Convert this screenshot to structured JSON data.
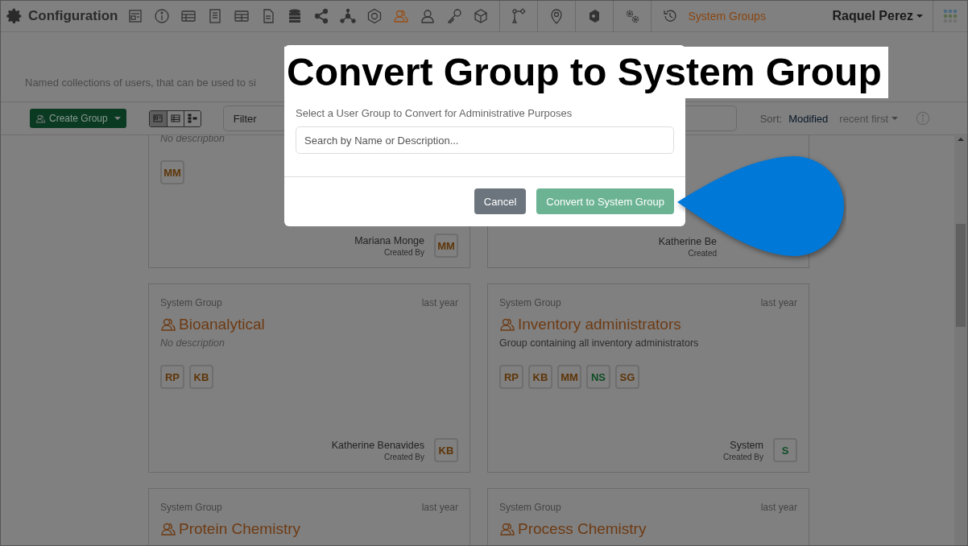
{
  "app": {
    "title": "Configuration",
    "section": "System Groups",
    "user": "Raquel Perez"
  },
  "toolbar_icons": [
    {
      "kind": "form",
      "selected": false
    },
    {
      "kind": "info",
      "selected": false
    },
    {
      "kind": "table",
      "selected": false
    },
    {
      "kind": "book",
      "selected": false
    },
    {
      "kind": "grid",
      "selected": false
    },
    {
      "kind": "document",
      "selected": false
    },
    {
      "kind": "database",
      "selected": false
    },
    {
      "kind": "share",
      "selected": false
    },
    {
      "kind": "network",
      "selected": false
    },
    {
      "kind": "hexagon",
      "selected": false
    },
    {
      "kind": "group",
      "selected": true
    },
    {
      "kind": "user",
      "selected": false
    },
    {
      "kind": "key",
      "selected": false
    },
    {
      "kind": "cube",
      "selected": false
    },
    {
      "kind": "branch",
      "selected": false
    },
    {
      "kind": "pin",
      "selected": false
    },
    {
      "kind": "shield",
      "selected": false
    },
    {
      "kind": "gears",
      "selected": false
    },
    {
      "kind": "history",
      "selected": false
    }
  ],
  "page": {
    "description": "Named collections of users, that can be used to si"
  },
  "actions": {
    "create_label": "Create Group",
    "views": [
      {
        "kind": "cards",
        "selected": true
      },
      {
        "kind": "list",
        "selected": false
      },
      {
        "kind": "tree",
        "selected": false
      }
    ],
    "filter_placeholder": "Filter",
    "sort_label": "Sort:",
    "sort_field": "Modified",
    "sort_order": "recent first"
  },
  "groups": [
    {
      "description": "No description",
      "description_empty": true,
      "members": [
        {
          "initials": "MM",
          "color": "#5e3508"
        }
      ],
      "creator": "Mariana Monge",
      "creator_caption": "Created By",
      "creator_avatar": {
        "initials": "MM",
        "color": "#5e3508"
      }
    },
    {
      "creator": "Katherine Be",
      "creator_caption": "Created"
    },
    {
      "type": "System Group",
      "time": "last year",
      "name": "Bioanalytical",
      "description": "No description",
      "description_empty": true,
      "members": [
        {
          "initials": "RP",
          "color": "#5e3508"
        },
        {
          "initials": "KB",
          "color": "#5e3508"
        }
      ],
      "creator": "Katherine Benavides",
      "creator_caption": "Created By",
      "creator_avatar": {
        "initials": "KB",
        "color": "#5e3508"
      }
    },
    {
      "type": "System Group",
      "time": "last year",
      "name": "Inventory administrators",
      "description": "Group containing all inventory administrators",
      "description_empty": false,
      "members": [
        {
          "initials": "RP",
          "color": "#5e3508"
        },
        {
          "initials": "KB",
          "color": "#5e3508"
        },
        {
          "initials": "MM",
          "color": "#5e3508"
        },
        {
          "initials": "NS",
          "color": "#0f4d26"
        },
        {
          "initials": "SG",
          "color": "#5e3508"
        }
      ],
      "creator": "System",
      "creator_caption": "Created By",
      "creator_avatar": {
        "initials": "S",
        "color": "#0f4d26"
      }
    },
    {
      "type": "System Group",
      "time": "last year",
      "name": "Protein Chemistry"
    },
    {
      "type": "System Group",
      "time": "last year",
      "name": "Process Chemistry"
    }
  ],
  "dialog": {
    "title": "Convert Group to System Group",
    "label": "Select a User Group to Convert for Administrative Purposes",
    "search_placeholder": "Search by Name or Description...",
    "buttons": [
      {
        "label": "Cancel",
        "kind": "secondary"
      },
      {
        "label": "Convert to System Group",
        "kind": "primary"
      }
    ]
  }
}
